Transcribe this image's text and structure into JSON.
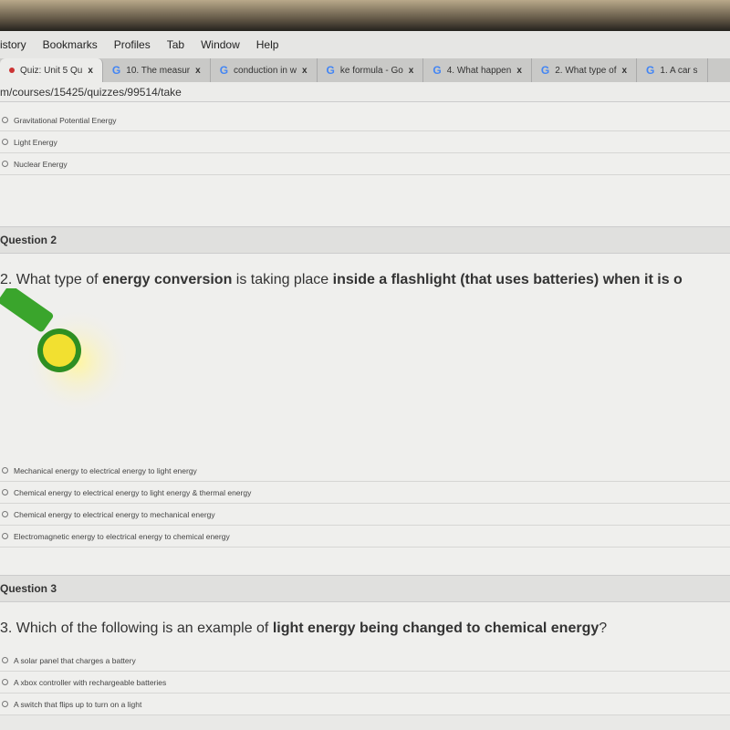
{
  "menu": [
    "istory",
    "Bookmarks",
    "Profiles",
    "Tab",
    "Window",
    "Help"
  ],
  "tabs": [
    {
      "label": "Quiz: Unit 5 Qu",
      "active": true,
      "icon": "canvas-icon"
    },
    {
      "label": "10. The measur",
      "icon": "google-icon"
    },
    {
      "label": "conduction in w",
      "icon": "google-icon"
    },
    {
      "label": "ke formula - Go",
      "icon": "google-icon"
    },
    {
      "label": "4. What happen",
      "icon": "google-icon"
    },
    {
      "label": "2. What type of",
      "icon": "google-icon"
    },
    {
      "label": "1. A car s",
      "icon": "google-icon"
    }
  ],
  "google_glyph": "G",
  "close_glyph": "x",
  "url": "m/courses/15425/quizzes/99514/take",
  "q1": {
    "options": [
      "Gravitational Potential Energy",
      "Light Energy",
      "Nuclear Energy"
    ]
  },
  "q2": {
    "header": "Question 2",
    "segments": [
      {
        "t": "2. What type of ",
        "b": false
      },
      {
        "t": "energy conversion",
        "b": true
      },
      {
        "t": " is taking place ",
        "b": false
      },
      {
        "t": "inside a flashlight (that uses batteries) when it is o",
        "b": true
      }
    ],
    "options": [
      "Mechanical energy to electrical energy to light energy",
      "Chemical energy to electrical energy to light energy & thermal energy",
      "Chemical energy to electrical energy to mechanical energy",
      "Electromagnetic energy to electrical energy to chemical energy"
    ]
  },
  "q3": {
    "header": "Question 3",
    "segments": [
      {
        "t": "3. Which of the following is an example of ",
        "b": false
      },
      {
        "t": "light energy being changed to chemical energy",
        "b": true
      },
      {
        "t": "?",
        "b": false
      }
    ],
    "options": [
      "A solar panel that charges a battery",
      "A xbox controller with rechargeable batteries",
      "A switch that flips up to turn on a light"
    ]
  }
}
